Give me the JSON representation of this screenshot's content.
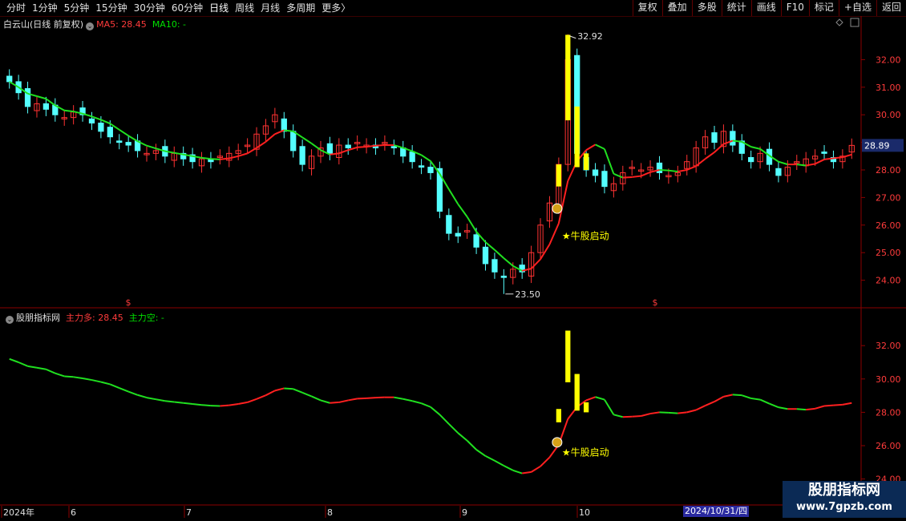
{
  "toolbar": {
    "periods": [
      "分时",
      "1分钟",
      "5分钟",
      "15分钟",
      "30分钟",
      "60分钟",
      "日线",
      "周线",
      "月线",
      "多周期",
      "更多"
    ],
    "more_arrow": "〉",
    "buttons": [
      "复权",
      "叠加",
      "多股",
      "统计",
      "画线",
      "F10",
      "标记",
      "+自选",
      "返回"
    ]
  },
  "main_panel": {
    "stock_name": "白云山(日线 前复权)",
    "ma5_label": "MA5: 28.45",
    "ma10_label": "MA10: -",
    "high_label": "32.92",
    "low_label": "23.50",
    "signal_label": "★牛股启动",
    "current_price": "28.89",
    "dollar_marker": "$"
  },
  "sub_panel": {
    "indicator_name": "股朋指标网",
    "bull_label": "主力多: 28.45",
    "bear_label": "主力空: -",
    "signal_label": "★牛股启动"
  },
  "date_axis": {
    "labels": [
      "2024年",
      "6",
      "7",
      "8",
      "9",
      "10"
    ],
    "cursor_date": "2024/10/31/四"
  },
  "watermark": {
    "line1": "股朋指标网",
    "line2": "www.7gpzb.com"
  },
  "colors": {
    "up": "#ff3232",
    "down": "#54ffff",
    "ma_up": "#ff2020",
    "ma_down": "#20e020",
    "signal": "#ffff00",
    "axis": "#8b0000"
  },
  "chart_data": [
    {
      "type": "candlestick",
      "title": "白云山(日线 前复权)",
      "y_ticks": [
        24.0,
        25.0,
        26.0,
        27.0,
        28.0,
        29.0,
        30.0,
        31.0,
        32.0
      ],
      "ylim": [
        23.0,
        33.0
      ],
      "high": 32.92,
      "low": 23.5,
      "last": 28.89,
      "close_series": [
        31.2,
        30.8,
        30.3,
        30.4,
        30.2,
        30.0,
        29.9,
        30.1,
        30.0,
        29.7,
        29.4,
        29.2,
        29.0,
        28.9,
        28.7,
        28.6,
        28.7,
        28.5,
        28.6,
        28.4,
        28.3,
        28.4,
        28.3,
        28.5,
        28.6,
        28.7,
        28.9,
        29.3,
        29.6,
        30.0,
        29.4,
        28.7,
        28.2,
        28.5,
        28.8,
        28.6,
        28.9,
        28.8,
        29.0,
        28.9,
        28.8,
        29.0,
        28.8,
        28.5,
        28.3,
        28.1,
        27.9,
        26.5,
        25.7,
        25.6,
        25.8,
        25.2,
        24.6,
        24.3,
        24.1,
        24.4,
        24.3,
        25.0,
        26.0,
        26.8,
        28.2,
        32.0,
        28.6,
        28.0,
        27.8,
        27.4,
        27.5,
        27.9,
        28.1,
        28.0,
        28.1,
        27.9,
        27.8,
        27.9,
        28.3,
        28.8,
        29.2,
        29.0,
        29.4,
        28.9,
        28.6,
        28.3,
        28.6,
        28.2,
        27.8,
        28.1,
        28.3,
        28.4,
        28.5,
        28.6,
        28.3,
        28.5,
        28.89
      ]
    },
    {
      "type": "line",
      "title": "股朋指标网",
      "y_ticks": [
        24.0,
        26.0,
        28.0,
        30.0,
        32.0
      ],
      "ylim": [
        23.5,
        33.5
      ],
      "series": [
        {
          "name": "主力多",
          "last": 28.45
        },
        {
          "name": "主力空",
          "last": null
        }
      ]
    }
  ]
}
